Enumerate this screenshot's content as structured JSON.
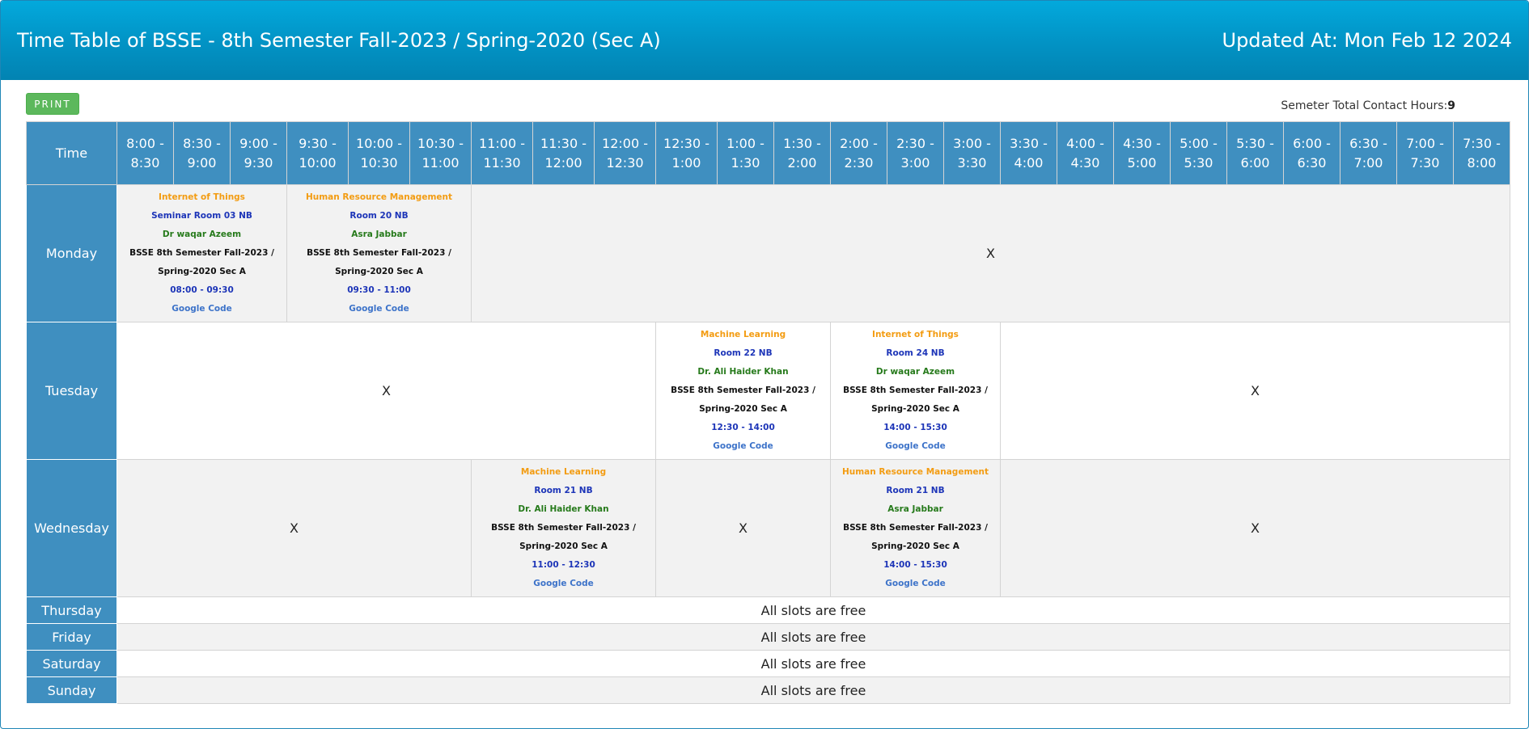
{
  "header": {
    "title": "Time Table of BSSE - 8th Semester Fall-2023 / Spring-2020 (Sec A)",
    "updated": "Updated At: Mon Feb 12 2024"
  },
  "toolbar": {
    "print_label": "PRINT",
    "contact_label": "Semeter Total Contact Hours:",
    "contact_value": "9"
  },
  "table": {
    "corner": "Time",
    "slots": [
      "8:00 - 8:30",
      "8:30 - 9:00",
      "9:00 - 9:30",
      "9:30 - 10:00",
      "10:00 - 10:30",
      "10:30 - 11:00",
      "11:00 - 11:30",
      "11:30 - 12:00",
      "12:00 - 12:30",
      "12:30 - 1:00",
      "1:00 - 1:30",
      "1:30 - 2:00",
      "2:00 - 2:30",
      "2:30 - 3:00",
      "3:00 - 3:30",
      "3:30 - 4:00",
      "4:00 - 4:30",
      "4:30 - 5:00",
      "5:00 - 5:30",
      "5:30 - 6:00",
      "6:00 - 6:30",
      "6:30 - 7:00",
      "7:00 - 7:30",
      "7:30 - 8:00"
    ],
    "empty_mark": "X",
    "free_text": "All slots are free",
    "days": [
      "Monday",
      "Tuesday",
      "Wednesday",
      "Thursday",
      "Friday",
      "Saturday",
      "Sunday"
    ]
  },
  "classes": {
    "mon_iot": {
      "course": "Internet of Things",
      "room": "Seminar Room 03 NB",
      "teacher": "Dr waqar Azeem",
      "section1": "BSSE 8th Semester Fall-2023 /",
      "section2": "Spring-2020 Sec A",
      "time": "08:00 - 09:30",
      "link": "Google Code"
    },
    "mon_hrm": {
      "course": "Human Resource Management",
      "room": "Room 20 NB",
      "teacher": "Asra Jabbar",
      "section1": "BSSE 8th Semester Fall-2023 /",
      "section2": "Spring-2020 Sec A",
      "time": "09:30 - 11:00",
      "link": "Google Code"
    },
    "tue_ml": {
      "course": "Machine Learning",
      "room": "Room 22 NB",
      "teacher": "Dr. Ali Haider Khan",
      "section1": "BSSE 8th Semester Fall-2023 /",
      "section2": "Spring-2020 Sec A",
      "time": "12:30 - 14:00",
      "link": "Google Code"
    },
    "tue_iot": {
      "course": "Internet of Things",
      "room": "Room 24 NB",
      "teacher": "Dr waqar Azeem",
      "section1": "BSSE 8th Semester Fall-2023 /",
      "section2": "Spring-2020 Sec A",
      "time": "14:00 - 15:30",
      "link": "Google Code"
    },
    "wed_ml": {
      "course": "Machine Learning",
      "room": "Room 21 NB",
      "teacher": "Dr. Ali Haider Khan",
      "section1": "BSSE 8th Semester Fall-2023 /",
      "section2": "Spring-2020 Sec A",
      "time": "11:00 - 12:30",
      "link": "Google Code"
    },
    "wed_hrm": {
      "course": "Human Resource Management",
      "room": "Room 21 NB",
      "teacher": "Asra Jabbar",
      "section1": "BSSE 8th Semester Fall-2023 /",
      "section2": "Spring-2020 Sec A",
      "time": "14:00 - 15:30",
      "link": "Google Code"
    }
  },
  "colors": {
    "header": "#0294c6",
    "table_header": "#3f8fc0",
    "course": "#f39c12",
    "room": "#1d35b8",
    "teacher": "#267a1b",
    "link": "#3d73c9",
    "print_button": "#5cb85c"
  }
}
